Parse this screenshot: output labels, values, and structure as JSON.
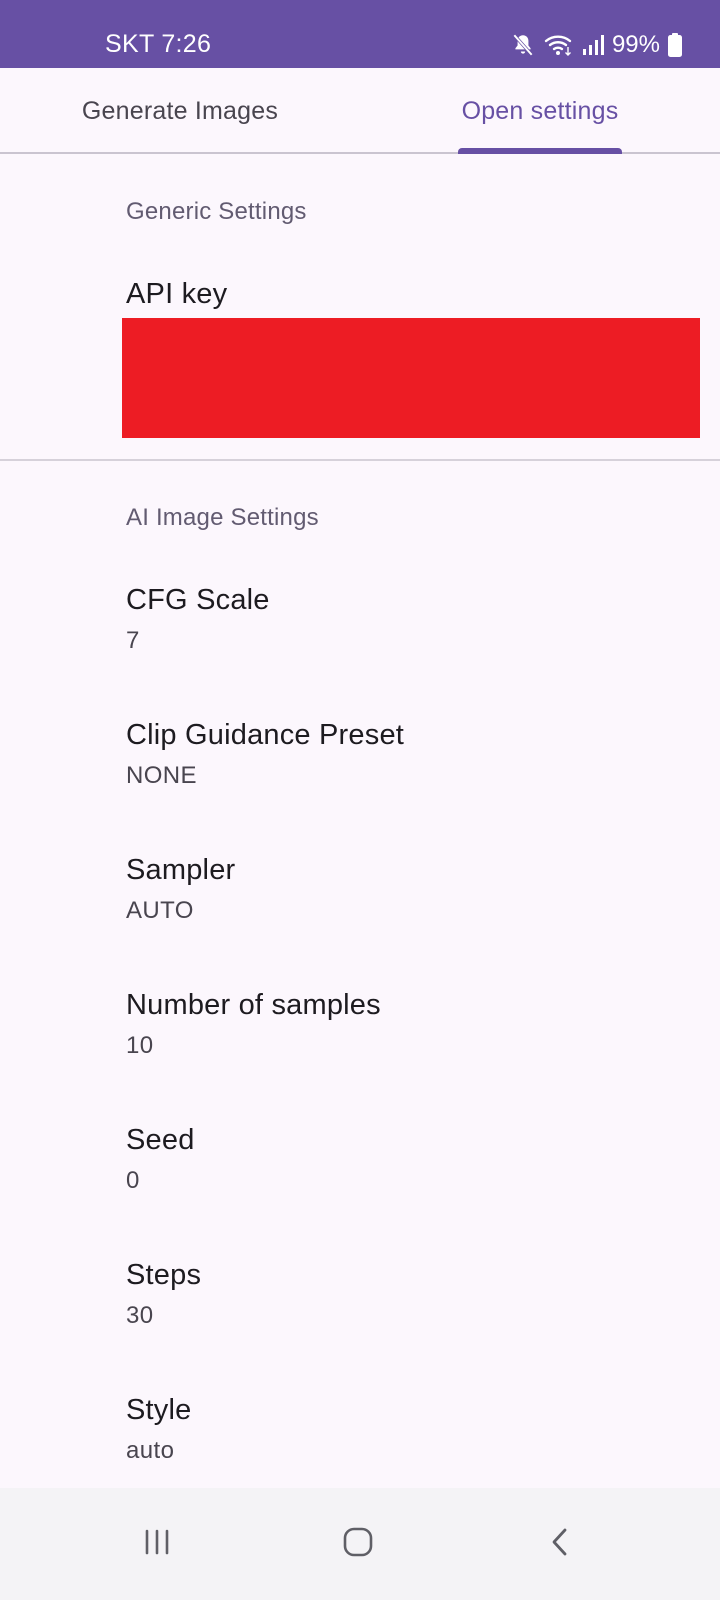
{
  "status_bar": {
    "time": "SKT 7:26",
    "battery": "99%",
    "icons": [
      "mute-icon",
      "wifi-icon",
      "signal-icon",
      "battery-icon"
    ],
    "background": "#6750A4"
  },
  "tabs": [
    {
      "label": "Generate Images",
      "selected": false
    },
    {
      "label": "Open settings",
      "selected": true
    }
  ],
  "generic": {
    "header": "Generic Settings",
    "api_key_title": "API key"
  },
  "ai": {
    "header": "AI Image Settings",
    "items": [
      {
        "title": "CFG Scale",
        "value": "7"
      },
      {
        "title": "Clip Guidance Preset",
        "value": "NONE"
      },
      {
        "title": "Sampler",
        "value": "AUTO"
      },
      {
        "title": "Number of samples",
        "value": "10"
      },
      {
        "title": "Seed",
        "value": "0"
      },
      {
        "title": "Steps",
        "value": "30"
      },
      {
        "title": "Style",
        "value": "auto"
      }
    ]
  },
  "nav": {
    "icons": [
      "recent-apps-icon",
      "home-icon",
      "back-icon"
    ]
  },
  "colors": {
    "accent": "#6750A4",
    "redaction": "#ED1C24"
  }
}
